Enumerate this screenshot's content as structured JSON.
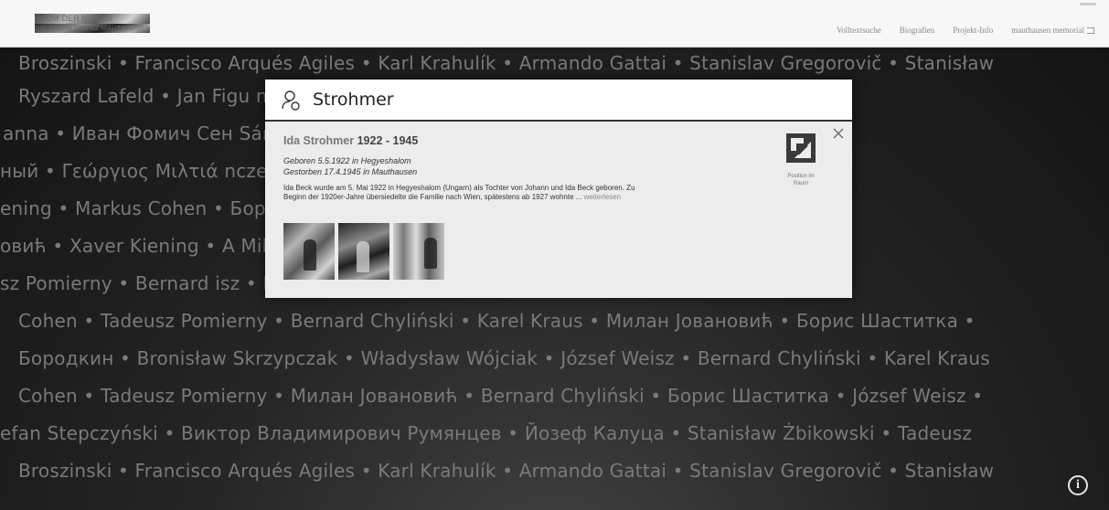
{
  "header": {
    "brand_title": "RAUM DER NAMEN",
    "brand_subtitle": "DIE TOTEN DES KZ MAUTHAUSEN",
    "nav": [
      "Volltextsuche",
      "Biografien",
      "Projekt-Info",
      "mauthausen memorial"
    ]
  },
  "names_rows": [
    "Broszinski • Francisco Arqués Agiles • Karl Krahulík • Armando Gattai • Stanislav Gregorovič • Stanisław",
    "Ryszard Lafeld • Jan Figu                                                                                        mia Zukiermann • Тула",
    "anna • Иван Фомич Сен                                                                                          Sánchez Conesa • Ede",
    "ный • Γεώργιος Μιλτιά                                                                                          ncze • Николай Захаро",
    "ening • Markus Cohen •                                                                                           Борис Шаститка • Józs",
    "овић • Xaver Kiening • A                                                                                         Milants • Милан Јован",
    "sz Pomierny • Bernard                                                                                            isz • Karel Kraus • Борис",
    "Cohen • Tadeusz Pomierny • Bernard Chyliński • Karel Kraus • Милан Јовановић • Борис Шаститка •",
    "Бородкин • Bronisław Skrzypczak • Władysław Wójciak • József Weisz • Bernard Chyliński • Karel Kraus",
    "Cohen • Tadeusz Pomierny • Милан Јовановић • Bernard Chyliński • Борис Шаститка • József Weisz •",
    "efan Stepczyński • Виктор Владимирович Румянцев • Йозеф Калуца • Stanisław Żbikowski • Tadeusz",
    "Broszinski • Francisco Arqués Agiles • Karl Krahulík • Armando Gattai • Stanislav Gregorovič • Stanisław"
  ],
  "popup": {
    "title": "Strohmer",
    "person_name": "Ida Strohmer",
    "person_years": "1922 - 1945",
    "born": "Geboren 5.5.1922 in Hegyeshalom",
    "died": "Gestorben 17.4.1945 in Mauthausen",
    "bio": "Ida Beck wurde am 5. Mai 1922 in Hegyeshalom (Ungarn) als Tochter von Johann und Ida Beck geboren. Zu Beginn der 1920er-Jahre übersiedelte die Familie nach Wien, spätestens ab 1927 wohnte ...",
    "more_link": "weiterlesen",
    "position_label": "Position im Raum"
  },
  "info_button": "i",
  "icons": [
    "person-icon",
    "close-icon",
    "position-icon",
    "info-icon",
    "external-link-icon"
  ]
}
